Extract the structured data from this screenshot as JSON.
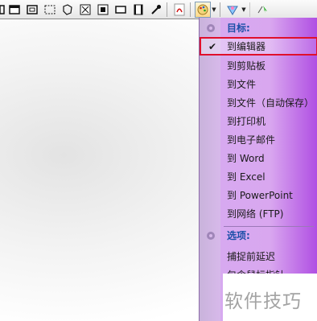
{
  "toolbar": {
    "buttons": [
      {
        "name": "fullscreen-capture-icon"
      },
      {
        "name": "window-capture-icon"
      },
      {
        "name": "region-capture-icon"
      },
      {
        "name": "freehand-capture-icon"
      },
      {
        "name": "fixed-region-icon"
      },
      {
        "name": "menu-capture-icon"
      },
      {
        "name": "object-capture-icon"
      },
      {
        "name": "video-capture-icon"
      },
      {
        "name": "color-picker-icon"
      },
      {
        "name": "pdf-icon"
      },
      {
        "name": "output-palette-icon"
      },
      {
        "name": "effects-icon"
      }
    ]
  },
  "menu": {
    "target_header": "目标:",
    "items": [
      {
        "label": "到编辑器",
        "checked": true
      },
      {
        "label": "到剪贴板"
      },
      {
        "label": "到文件"
      },
      {
        "label": "到文件（自动保存）"
      },
      {
        "label": "到打印机"
      },
      {
        "label": "到电子邮件"
      },
      {
        "label": "到 Word"
      },
      {
        "label": "到 Excel"
      },
      {
        "label": "到 PowerPoint"
      },
      {
        "label": "到网络 (FTP)"
      }
    ],
    "options_header": "选项:",
    "option_items": [
      {
        "label": "捕捉前延迟"
      },
      {
        "label": "包含鼠标指针"
      }
    ],
    "check_mark": "✔"
  },
  "watermark": "软件技巧",
  "colors": {
    "menu_purple": "#d9a7ef",
    "header_blue": "#1b4fa8",
    "selected_border": "#e0102c"
  }
}
